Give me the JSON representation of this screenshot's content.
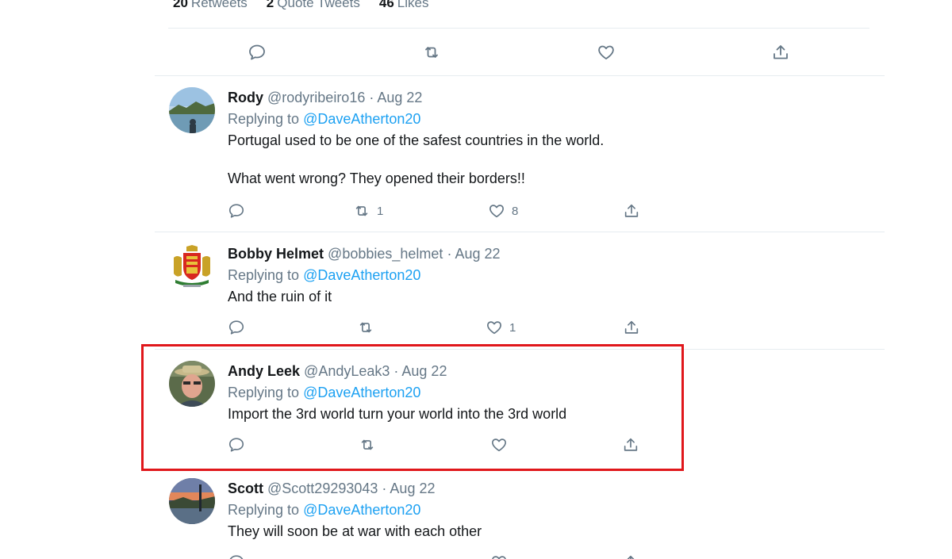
{
  "stats": [
    {
      "count": "20",
      "label": "Retweets"
    },
    {
      "count": "2",
      "label": "Quote Tweets"
    },
    {
      "count": "46",
      "label": "Likes"
    }
  ],
  "main_actions": [
    {
      "icon": "reply-icon"
    },
    {
      "icon": "retweet-icon"
    },
    {
      "icon": "like-icon"
    },
    {
      "icon": "share-icon"
    }
  ],
  "replies": [
    {
      "name": "Rody",
      "handle": "@rodyribeiro16",
      "date": "· Aug 22",
      "replying_prefix": "Replying to",
      "replying_to": "@DaveAtherton20",
      "text": [
        "Portugal used to be one of the safest countries in the world.",
        "What went wrong? They opened their borders!!"
      ],
      "retweets": "1",
      "likes": "8",
      "avatar_icon": "lake-photo"
    },
    {
      "name": "Bobby Helmet",
      "handle": "@bobbies_helmet",
      "date": "· Aug 22",
      "replying_prefix": "Replying to",
      "replying_to": "@DaveAtherton20",
      "text": [
        "And the ruin of it"
      ],
      "retweets": "",
      "likes": "1",
      "avatar_icon": "coat-of-arms"
    },
    {
      "name": "Andy Leek",
      "handle": "@AndyLeak3",
      "date": "· Aug 22",
      "replying_prefix": "Replying to",
      "replying_to": "@DaveAtherton20",
      "text": [
        "Import the 3rd world turn your world into the 3rd world"
      ],
      "retweets": "",
      "likes": "",
      "avatar_icon": "man-with-hat-photo"
    },
    {
      "name": "Scott",
      "handle": "@Scott29293043",
      "date": "· Aug 22",
      "replying_prefix": "Replying to",
      "replying_to": "@DaveAtherton20",
      "text": [
        "They will soon be at war with each other"
      ],
      "retweets": "",
      "likes": "",
      "avatar_icon": "sunset-photo"
    }
  ],
  "colors": {
    "accent": "#1da1f2",
    "muted": "#657786",
    "text": "#14171a",
    "divider": "#e6ecf0",
    "highlight_border": "#e0171b"
  }
}
